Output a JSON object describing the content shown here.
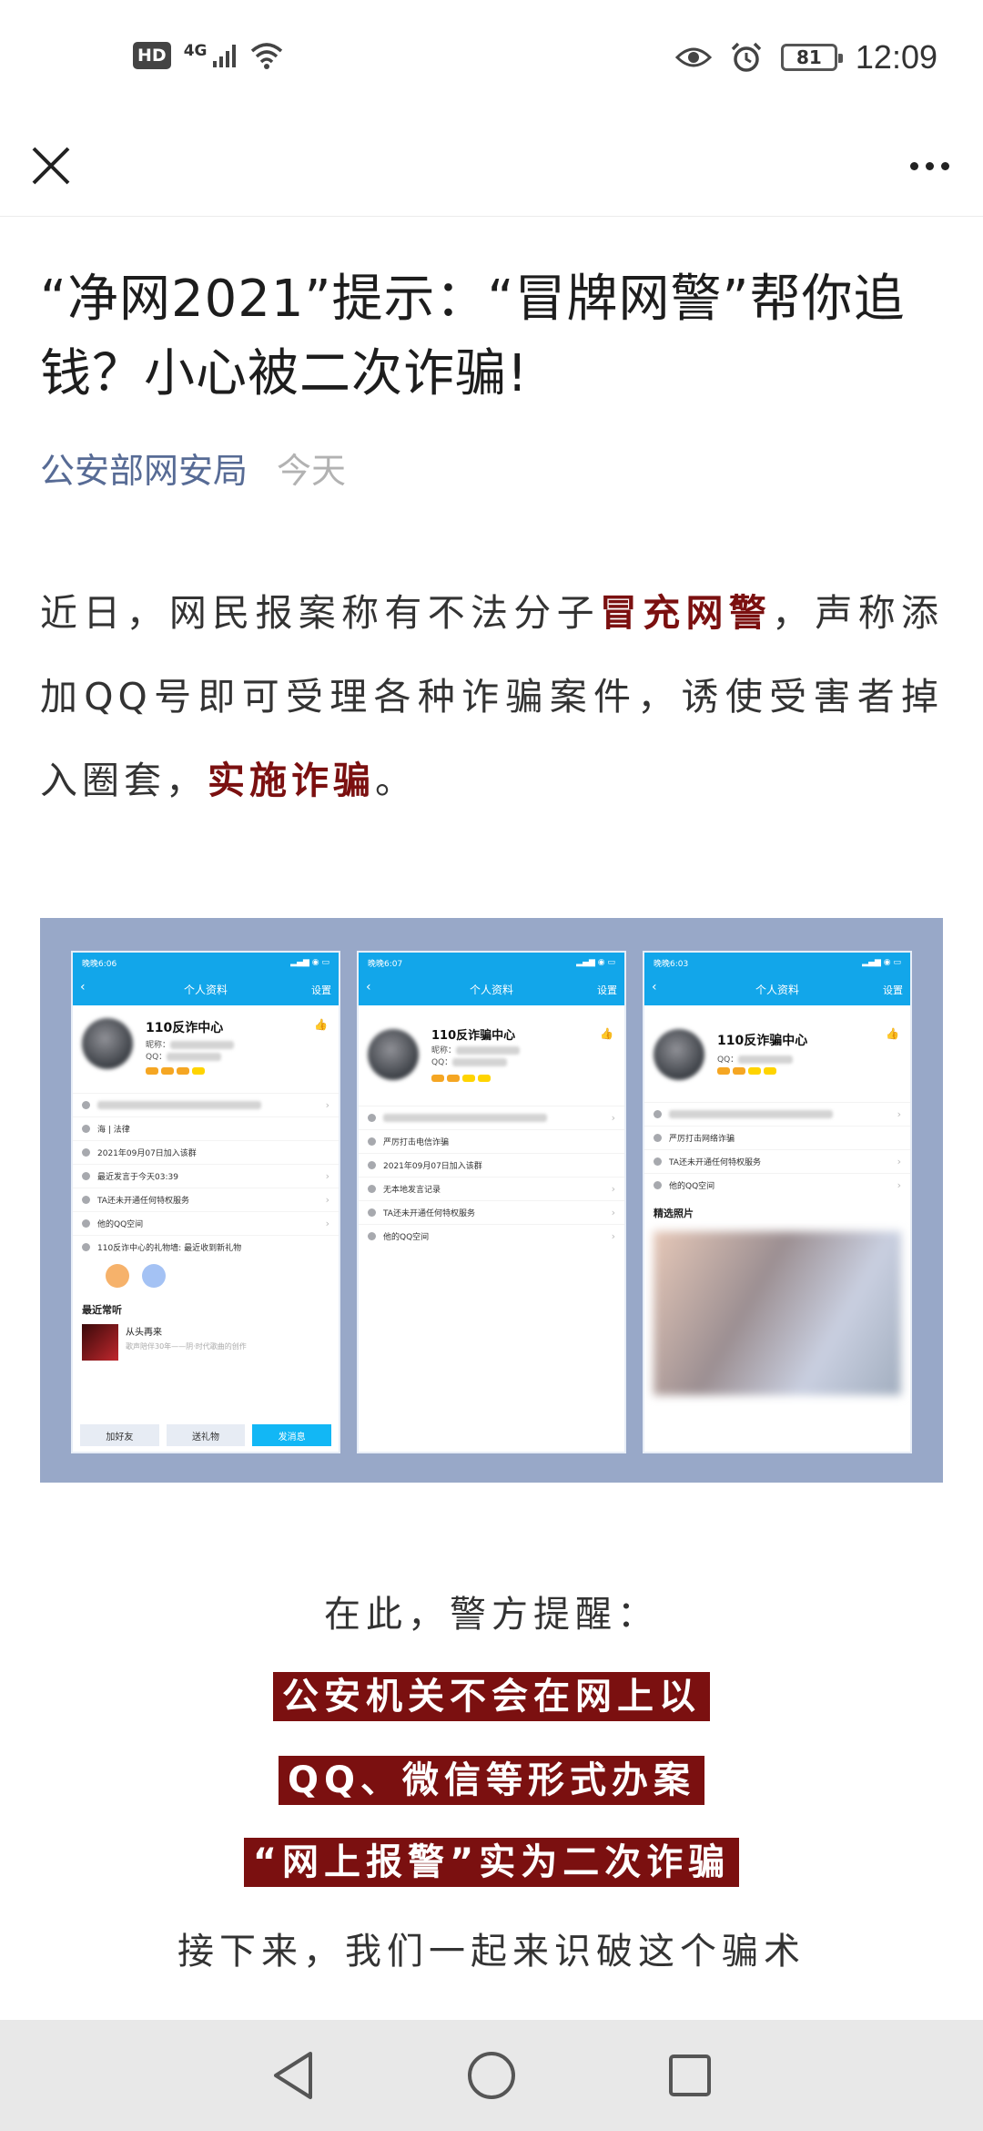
{
  "status_bar": {
    "hd": "HD",
    "network": "4G",
    "battery": "81",
    "time": "12:09"
  },
  "article": {
    "title": "“净网2021”提示：“冒牌网警”帮你追钱？小心被二次诈骗!",
    "author": "公安部网安局",
    "date": "今天",
    "para": {
      "p1": "近日，网民报案称有不法分子",
      "h1": "冒充网警",
      "p2": "，声称添加QQ号即可受理各种诈骗案件，诱使受害者掉入圈套，",
      "h2": "实施诈骗",
      "p3": "。"
    }
  },
  "figure": {
    "phones": [
      {
        "time": "晚晚6:06",
        "header": "个人资料",
        "settings": "设置",
        "name": "110反诈中心",
        "nick": "昵称：",
        "qq": "QQ：",
        "rows": [
          "海 | 法律",
          "2021年09月07日加入该群",
          "最近发言于今天03:39",
          "TA还未开通任何特权服务",
          "他的QQ空间",
          "110反诈中心的礼物墙: 最近收到新礼物"
        ],
        "recent_title": "最近常听",
        "song_title": "从头再来",
        "song_sub": "歌声陪伴30年——阴·时代歌曲的创作",
        "buttons": [
          "加好友",
          "送礼物",
          "发消息"
        ]
      },
      {
        "time": "晚晚6:07",
        "header": "个人资料",
        "settings": "设置",
        "name": "110反诈骗中心",
        "nick": "昵称：",
        "qq": "QQ：",
        "rows": [
          "严厉打击电信诈骗",
          "2021年09月07日加入该群",
          "无本地发言记录",
          "TA还未开通任何特权服务",
          "他的QQ空间"
        ]
      },
      {
        "time": "晚晚6:03",
        "header": "个人资料",
        "settings": "设置",
        "name": "110反诈骗中心",
        "qq": "QQ：",
        "rows": [
          "严厉打击网络诈骗",
          "TA还未开通任何特权服务",
          "他的QQ空间"
        ],
        "photos_title": "精选照片"
      }
    ]
  },
  "reminder": {
    "intro": "在此，警方提醒：",
    "b1": "公安机关不会在网上以",
    "b2": "QQ、微信等形式办案",
    "b3": "“网上报警”实为二次诈骗",
    "closing": "接下来，我们一起来识破这个骗术"
  },
  "colors": {
    "accent_link": "#576b95",
    "highlight": "#7b1010",
    "figure_bg": "#98a8c8",
    "qq_blue": "#12a6ea"
  }
}
